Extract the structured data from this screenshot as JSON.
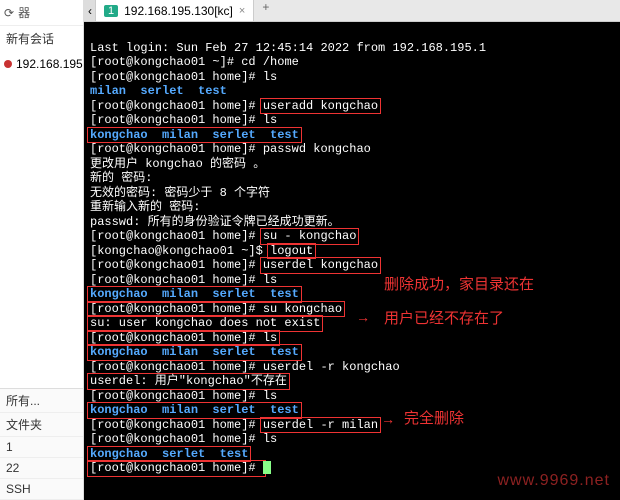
{
  "sidebar": {
    "header": "器",
    "session_label": "新有会话",
    "ip_partial": "192.168.195.",
    "bottom": [
      "所有...",
      "文件夹",
      "1",
      "22",
      "SSH"
    ]
  },
  "tabs": {
    "active_num": "1",
    "active_label": "192.168.195.130[kc]",
    "close": "×",
    "add": "+"
  },
  "term": {
    "l01a": "Last login: Sun Feb 27 12:45:14 2022 from 192.168.195.1",
    "l02p": "[root@kongchao01 ~]# ",
    "l02c": "cd /home",
    "l03p": "[root@kongchao01 home]# ",
    "l03c": "ls",
    "l04": "milan  serlet  test",
    "l05p": "[root@kongchao01 home]# ",
    "l05c": "useradd kongchao",
    "l06p": "[root@kongchao01 home]# ",
    "l06c": "ls",
    "l07": "kongchao  milan  serlet  test",
    "l08p": "[root@kongchao01 home]# ",
    "l08c": "passwd kongchao",
    "l09": "更改用户 kongchao 的密码 。",
    "l10": "新的 密码:",
    "l11": "无效的密码: 密码少于 8 个字符",
    "l12": "重新输入新的 密码:",
    "l13": "passwd: 所有的身份验证令牌已经成功更新。",
    "l14p": "[root@kongchao01 home]# ",
    "l14c": "su - kongchao",
    "l15p": "[kongchao@kongchao01 ~]$ ",
    "l15c": "logout",
    "l16p": "[root@kongchao01 home]# ",
    "l16c": "userdel kongchao",
    "l17p": "[root@kongchao01 home]# ",
    "l17c": "ls",
    "l18": "kongchao  milan  serlet  test",
    "l19p": "[root@kongchao01 home]# ",
    "l19c": "su kongchao",
    "l20": "su: user kongchao does not exist",
    "l21p": "[root@kongchao01 home]# ",
    "l21c": "ls",
    "l22": "kongchao  milan  serlet  test",
    "l23p": "[root@kongchao01 home]# ",
    "l23c": "userdel -r kongchao",
    "l24a": "userdel: 用户\"kongchao\"不存在",
    "l25p": "[root@kongchao01 home]# ",
    "l25c": "ls",
    "l26": "kongchao  milan  serlet  test",
    "l27p": "[root@kongchao01 home]# ",
    "l27c": "userdel -r milan",
    "l28p": "[root@kongchao01 home]# ",
    "l28c": "ls",
    "l29": "kongchao  serlet  test",
    "l30p": "[root@kongchao01 home]# "
  },
  "anno": {
    "a1": "删除成功，家目录还在",
    "a2": "用户已经不存在了",
    "a3": "完全删除",
    "arrow": "→"
  },
  "watermark": "www.9969.net"
}
